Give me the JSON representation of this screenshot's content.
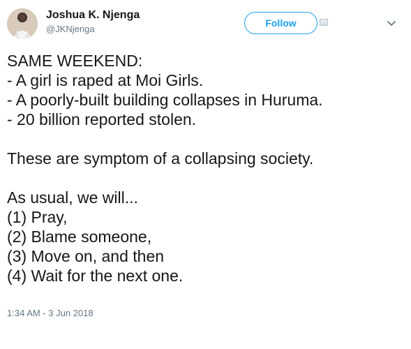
{
  "tweet": {
    "author": {
      "display_name": "Joshua K. Njenga",
      "handle": "@JKNjenga"
    },
    "actions": {
      "follow_label": "Follow"
    },
    "body": {
      "line_1": "SAME WEEKEND:",
      "line_2": "- A girl is raped at Moi Girls.",
      "line_3": "- A poorly-built building collapses in Huruma.",
      "line_4": "- 20 billion reported stolen.",
      "line_5": "These are symptom of a collapsing society.",
      "line_6": "As usual, we will...",
      "line_7": "(1) Pray,",
      "line_8": "(2) Blame someone,",
      "line_9": "(3) Move on, and then",
      "line_10": "(4) Wait for the next one."
    },
    "timestamp": "1:34 AM - 3 Jun 2018"
  },
  "icons": {
    "avatar": "avatar",
    "badge": "badge-icon",
    "menu": "chevron-down-icon"
  },
  "colors": {
    "accent": "#1da1f2",
    "text": "#14171a",
    "muted": "#657786"
  }
}
